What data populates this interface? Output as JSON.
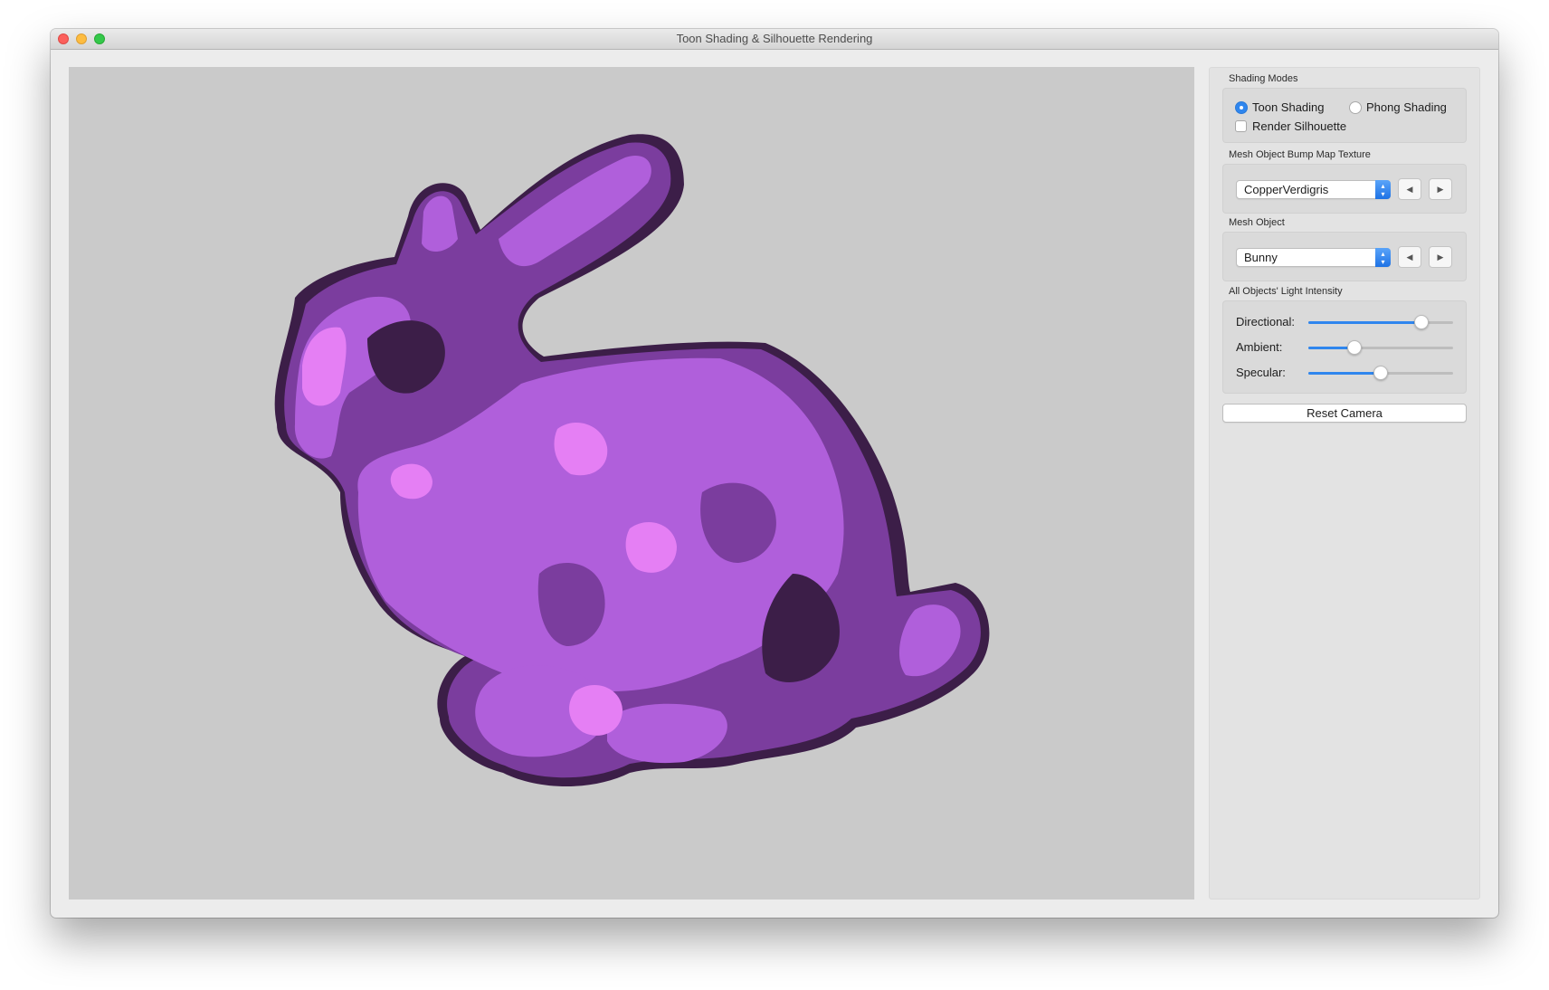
{
  "window": {
    "title": "Toon Shading & Silhouette Rendering"
  },
  "panel": {
    "shading_modes": {
      "label": "Shading Modes",
      "toon_label": "Toon Shading",
      "toon_selected": true,
      "phong_label": "Phong Shading",
      "phong_selected": false,
      "silhouette_label": "Render Silhouette",
      "silhouette_checked": false
    },
    "bump_map": {
      "label": "Mesh Object Bump Map Texture",
      "value": "CopperVerdigris",
      "prev_icon": "left-triangle-icon",
      "next_icon": "right-triangle-icon"
    },
    "mesh_object": {
      "label": "Mesh Object",
      "value": "Bunny",
      "prev_icon": "left-triangle-icon",
      "next_icon": "right-triangle-icon"
    },
    "light_intensity": {
      "label": "All Objects' Light Intensity",
      "directional_label": "Directional:",
      "directional_value": 0.78,
      "ambient_label": "Ambient:",
      "ambient_value": 0.32,
      "specular_label": "Specular:",
      "specular_value": 0.5
    },
    "reset_camera_label": "Reset Camera"
  },
  "colors": {
    "accent": "#2f86ee",
    "toon_highlight": "#e57ff4",
    "toon_light": "#b05fdb",
    "toon_mid": "#7b3d9e",
    "toon_dark": "#3c1e48",
    "viewport_bg": "#cacaca"
  }
}
